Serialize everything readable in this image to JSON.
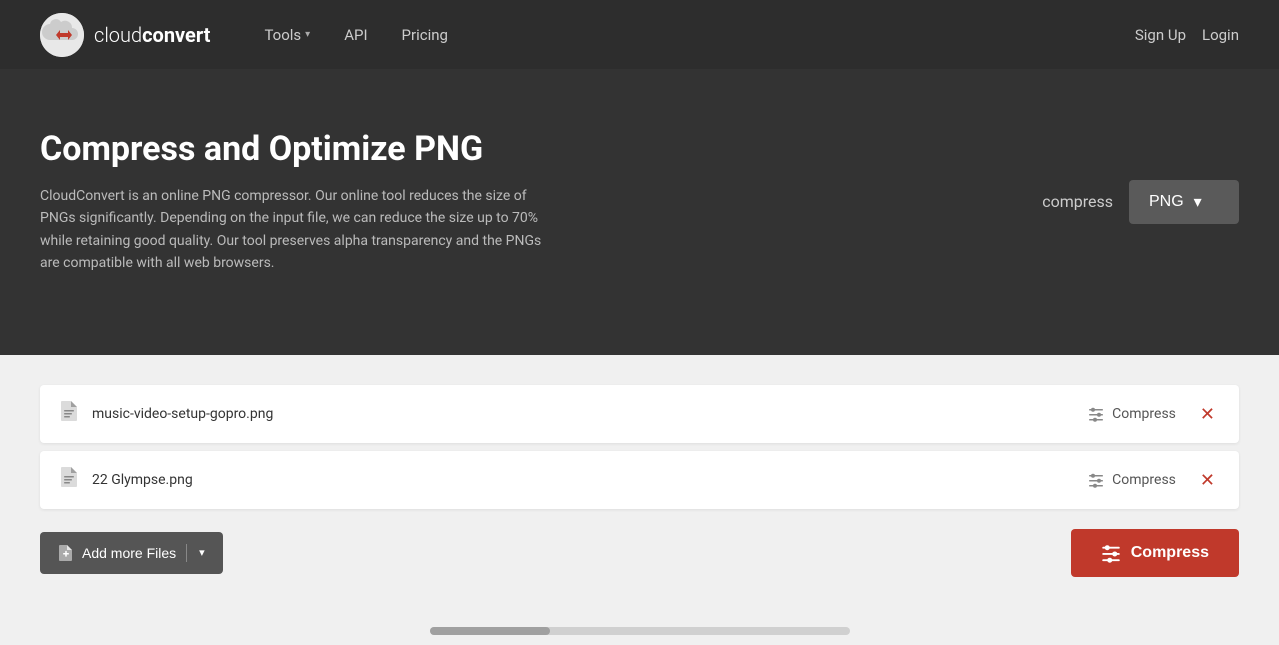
{
  "nav": {
    "logo_text_light": "cloud",
    "logo_text_bold": "convert",
    "links": [
      {
        "label": "Tools",
        "has_dropdown": true
      },
      {
        "label": "API",
        "has_dropdown": false
      },
      {
        "label": "Pricing",
        "has_dropdown": false
      }
    ],
    "right_links": [
      {
        "label": "Sign Up"
      },
      {
        "label": "Login"
      }
    ]
  },
  "hero": {
    "title": "Compress and Optimize PNG",
    "description": "CloudConvert is an online PNG compressor. Our online tool reduces the size of PNGs significantly. Depending on the input file, we can reduce the size up to 70% while retaining good quality. Our tool preserves alpha transparency and the PNGs are compatible with all web browsers.",
    "action_label": "compress",
    "format_label": "PNG",
    "chevron": "▾"
  },
  "files": [
    {
      "name": "music-video-setup-gopro.png"
    },
    {
      "name": "22 Glympse.png"
    }
  ],
  "file_compress_label": "Compress",
  "add_files_btn_label": "Add more Files",
  "compress_main_btn_label": "Compress",
  "icons": {
    "file": "🗋",
    "sliders": "⊞",
    "close": "✕",
    "add_file": "⊞",
    "compress_sliders": "⊞",
    "chevron_down": "▾"
  }
}
